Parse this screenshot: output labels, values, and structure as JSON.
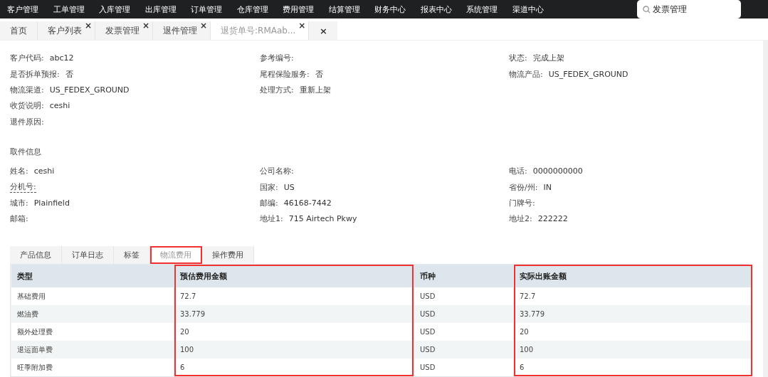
{
  "top_nav": {
    "items": [
      {
        "label": "客户管理"
      },
      {
        "label": "工单管理"
      },
      {
        "label": "入库管理"
      },
      {
        "label": "出库管理"
      },
      {
        "label": "订单管理"
      },
      {
        "label": "仓库管理"
      },
      {
        "label": "费用管理"
      },
      {
        "label": "结算管理"
      },
      {
        "label": "财务中心"
      },
      {
        "label": "报表中心"
      },
      {
        "label": "系统管理"
      },
      {
        "label": "渠道中心"
      }
    ],
    "search": {
      "value": "发票管理"
    }
  },
  "page_tabs": [
    {
      "label": "首页",
      "selected": false
    },
    {
      "label": "客户列表",
      "selected": false,
      "close": "×"
    },
    {
      "label": "发票管理",
      "selected": false,
      "close": "×"
    },
    {
      "label": "退件管理",
      "selected": false,
      "close": "×"
    },
    {
      "label": "退货单号:RMAab...",
      "selected": true,
      "close": "×"
    }
  ],
  "close_all": "×",
  "order_info": {
    "columns": [
      [
        {
          "label": "客户代码:",
          "value": "abc12"
        },
        {
          "label": "是否拆单预报:",
          "value": "否"
        },
        {
          "label": "物流渠道:",
          "value": "US_FEDEX_GROUND"
        },
        {
          "label": "收货说明:",
          "value": "ceshi"
        },
        {
          "label": "退件原因:"
        }
      ],
      [
        {
          "label": "参考编号:"
        },
        {
          "label": "尾程保险服务:",
          "value": "否"
        },
        {
          "label": "处理方式:",
          "value": "重新上架"
        }
      ],
      [
        {
          "label": "状态:",
          "value": "完成上架"
        },
        {
          "label": "物流产品:",
          "value": "US_FEDEX_GROUND"
        }
      ]
    ]
  },
  "pickup_info": {
    "title": "取件信息",
    "columns": [
      [
        {
          "label": "姓名:",
          "value": "ceshi"
        },
        {
          "label": "分机号:",
          "underlined": true
        },
        {
          "label": "城市:",
          "value": "Plainfield"
        },
        {
          "label": "邮箱:"
        }
      ],
      [
        {
          "label": "公司名称:"
        },
        {
          "label": "国家:",
          "value": "US"
        },
        {
          "label": "邮编:",
          "value": "46168-7442"
        },
        {
          "label": "地址1:",
          "value": "715 Airtech Pkwy"
        }
      ],
      [
        {
          "label": "电话:",
          "value": "0000000000"
        },
        {
          "label": "省份/州:",
          "value": "IN"
        },
        {
          "label": "门牌号:"
        },
        {
          "label": "地址2:",
          "value": "222222"
        }
      ]
    ]
  },
  "detail_tabs": [
    {
      "label": "产品信息",
      "selected": false,
      "highlighted": false
    },
    {
      "label": "订单日志",
      "selected": false,
      "highlighted": false
    },
    {
      "label": "标签",
      "selected": false,
      "highlighted": false
    },
    {
      "label": "物流费用",
      "selected": true,
      "highlighted": true
    },
    {
      "label": "操作费用",
      "selected": false,
      "highlighted": false
    }
  ],
  "table": {
    "columns": [
      {
        "label": "类型",
        "highlighted": false
      },
      {
        "label": "预估费用金额",
        "highlighted": true
      },
      {
        "label": "币种",
        "highlighted": false
      },
      {
        "label": "实际出账金额",
        "highlighted": true
      }
    ],
    "rows": [
      [
        "基础费用",
        "72.7",
        "USD",
        "72.7"
      ],
      [
        "燃油费",
        "33.779",
        "USD",
        "33.779"
      ],
      [
        "额外处理费",
        "20",
        "USD",
        "20"
      ],
      [
        "退运面单费",
        "100",
        "USD",
        "100"
      ],
      [
        "旺季附加费",
        "6",
        "USD",
        "6"
      ]
    ]
  }
}
